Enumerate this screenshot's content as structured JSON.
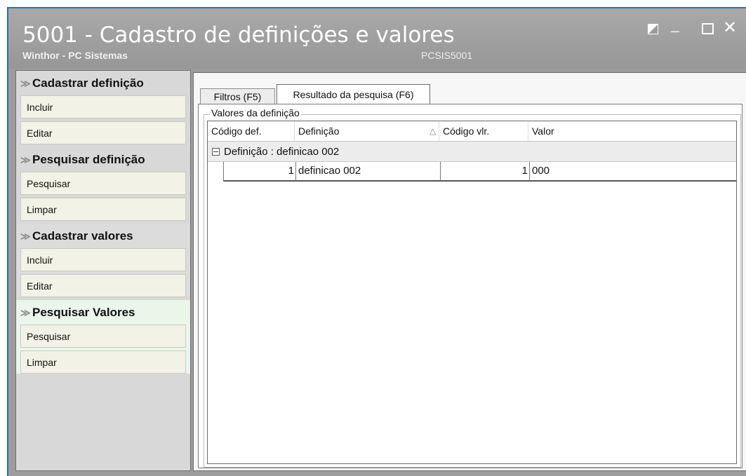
{
  "window": {
    "title": "5001 - Cadastro de definições e valores",
    "subtitle": "Winthor - PC Sistemas",
    "code": "PCSIS5001",
    "controls": {
      "minimize": "_",
      "close": "✕"
    }
  },
  "sidebar": {
    "groups": [
      {
        "header": "Cadastrar definição",
        "buttons": [
          "Incluir",
          "Editar"
        ]
      },
      {
        "header": "Pesquisar definição",
        "buttons": [
          "Pesquisar",
          "Limpar"
        ]
      },
      {
        "header": "Cadastrar valores",
        "buttons": [
          "Incluir",
          "Editar"
        ]
      },
      {
        "header": "Pesquisar Valores",
        "buttons": [
          "Pesquisar",
          "Limpar"
        ]
      }
    ],
    "chevron": "≫"
  },
  "tabs": [
    {
      "label": "Filtros (F5)",
      "active": false
    },
    {
      "label": "Resultado da pesquisa (F6)",
      "active": true
    }
  ],
  "results": {
    "legend": "Valores da definição",
    "columns": [
      "Código def.",
      "Definição",
      "Código vlr.",
      "Valor"
    ],
    "sort_indicator": "△",
    "group_row": "Definição : definicao 002",
    "rows": [
      {
        "codigo_def": "1",
        "definicao": "definicao 002",
        "codigo_vlr": "1",
        "valor": "000"
      }
    ]
  },
  "colors": {
    "titlebar": "#9c9c9c",
    "accent_border": "#1e73b8",
    "sidebar_button": "#f2f2e7"
  }
}
